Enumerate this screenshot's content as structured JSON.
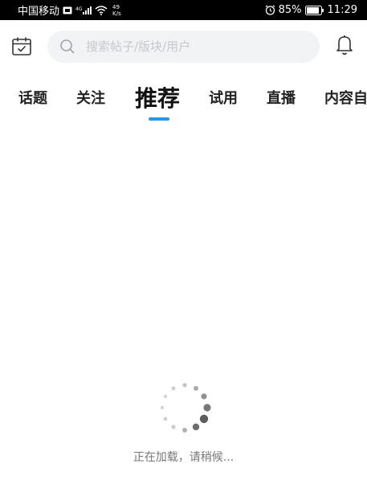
{
  "status_bar": {
    "carrier": "中国移动",
    "network": "4G",
    "net_speed_value": "49",
    "net_speed_unit": "K/s",
    "battery": "85%",
    "time": "11:29"
  },
  "header": {
    "search_placeholder": "搜索帖子/版块/用户"
  },
  "tabs": [
    {
      "label": "话题"
    },
    {
      "label": "关注"
    },
    {
      "label": "推荐"
    },
    {
      "label": "试用"
    },
    {
      "label": "直播"
    },
    {
      "label": "内容自"
    }
  ],
  "active_tab_index": 2,
  "loading": {
    "text": "正在加载，请稍候..."
  },
  "colors": {
    "accent": "#1e9bf0",
    "status_bar_bg": "#000000",
    "search_bg": "#f2f3f5",
    "placeholder": "#c6c8cc",
    "spinner": "#555555"
  },
  "icons": {
    "calendar": "calendar-check-icon",
    "search": "search-icon",
    "bell": "bell-icon",
    "alarm": "alarm-icon",
    "battery": "battery-icon",
    "wifi": "wifi-icon",
    "signal": "signal-icon",
    "sim": "sim-icon"
  }
}
